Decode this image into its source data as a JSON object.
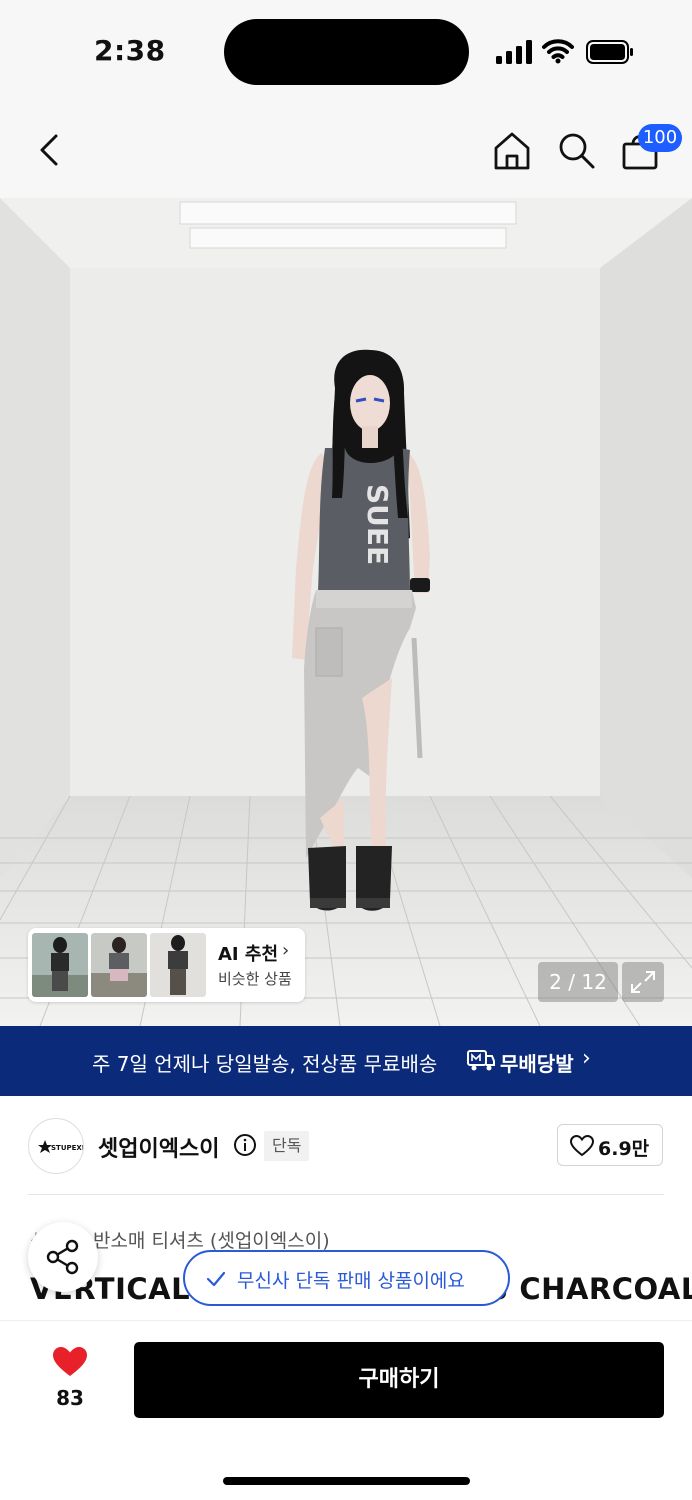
{
  "status_bar": {
    "time": "2:38"
  },
  "nav": {
    "cart_count": "100"
  },
  "gallery": {
    "shirt_print": "SUEE",
    "counter": "2 / 12",
    "ai_card": {
      "title": "AI 추천",
      "subtitle": "비슷한 상품"
    }
  },
  "promo_banner": {
    "text": "주 7일 언제나 당일발송, 전상품 무료배송",
    "brand": "무배당발"
  },
  "brand": {
    "logo_text": "STUPEXE",
    "name": "셋업이엑스이",
    "tag": "단독",
    "likes": "6.9만"
  },
  "product": {
    "category": "반소매 티셔츠 (셋업이엑스이)",
    "title": "VERTICAL LOGO SLEEVELESS CHARCOAL",
    "exclusive_toast": "무신사 단독 판매 상품이에요"
  },
  "bottom_bar": {
    "wishlist_count": "83",
    "buy_label": "구매하기"
  },
  "colors": {
    "accent_blue": "#1e5dff",
    "banner_navy": "#0c2a7a",
    "heart_red": "#e8202a"
  }
}
